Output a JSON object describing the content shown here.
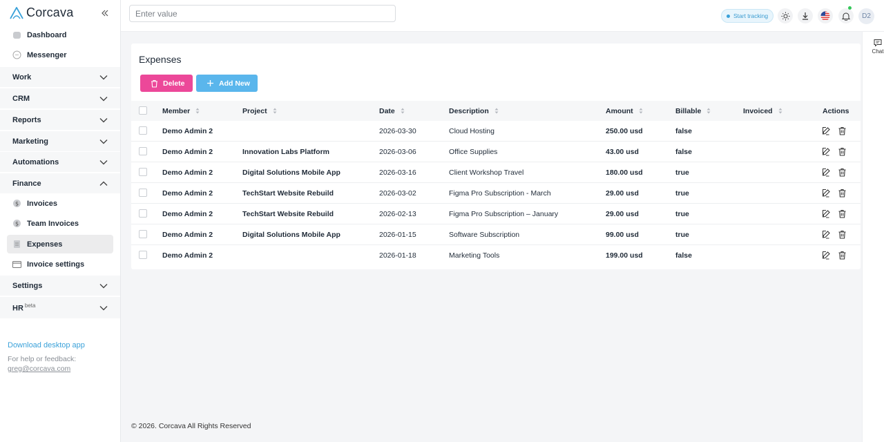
{
  "brand": {
    "name": "Corcava"
  },
  "sidebar": {
    "items": [
      {
        "label": "Dashboard",
        "icon": "home-icon"
      },
      {
        "label": "Messenger",
        "icon": "chat-bubble-icon"
      }
    ],
    "groups": [
      {
        "label": "Work",
        "expanded": false
      },
      {
        "label": "CRM",
        "expanded": false
      },
      {
        "label": "Reports",
        "expanded": false
      },
      {
        "label": "Marketing",
        "expanded": false
      },
      {
        "label": "Automations",
        "expanded": false
      },
      {
        "label": "Finance",
        "expanded": true
      }
    ],
    "finance_items": [
      {
        "label": "Invoices",
        "icon": "dollar-coin-icon"
      },
      {
        "label": "Team Invoices",
        "icon": "dollar-coin-icon"
      },
      {
        "label": "Expenses",
        "icon": "receipt-icon",
        "active": true
      },
      {
        "label": "Invoice settings",
        "icon": "card-icon"
      }
    ],
    "groups_after": [
      {
        "label": "Settings",
        "expanded": false
      },
      {
        "label": "HR",
        "badge": "beta",
        "expanded": false
      }
    ],
    "download_link": "Download desktop app",
    "help_text": "For help or feedback:",
    "help_email": "greg@corcava.com"
  },
  "topbar": {
    "search_placeholder": "Enter value",
    "track_label": "Start tracking",
    "avatar_initials": "D2",
    "accent": "#3aa1d9"
  },
  "chat": {
    "label": "Chat"
  },
  "expenses": {
    "title": "Expenses",
    "delete_label": "Delete",
    "add_label": "Add New",
    "columns": [
      "Member",
      "Project",
      "Date",
      "Description",
      "Amount",
      "Billable",
      "Invoiced",
      "Actions"
    ],
    "rows": [
      {
        "member": "Demo Admin 2",
        "project": "",
        "date": "2026-03-30",
        "description": "Cloud Hosting",
        "amount": "250.00 usd",
        "billable": "false",
        "invoiced": ""
      },
      {
        "member": "Demo Admin 2",
        "project": "Innovation Labs Platform",
        "date": "2026-03-06",
        "description": "Office Supplies",
        "amount": "43.00 usd",
        "billable": "false",
        "invoiced": ""
      },
      {
        "member": "Demo Admin 2",
        "project": "Digital Solutions Mobile App",
        "date": "2026-03-16",
        "description": "Client Workshop Travel",
        "amount": "180.00 usd",
        "billable": "true",
        "invoiced": ""
      },
      {
        "member": "Demo Admin 2",
        "project": "TechStart Website Rebuild",
        "date": "2026-03-02",
        "description": "Figma Pro Subscription - March",
        "amount": "29.00 usd",
        "billable": "true",
        "invoiced": ""
      },
      {
        "member": "Demo Admin 2",
        "project": "TechStart Website Rebuild",
        "date": "2026-02-13",
        "description": "Figma Pro Subscription – January",
        "amount": "29.00 usd",
        "billable": "true",
        "invoiced": ""
      },
      {
        "member": "Demo Admin 2",
        "project": "Digital Solutions Mobile App",
        "date": "2026-01-15",
        "description": "Software Subscription",
        "amount": "99.00 usd",
        "billable": "true",
        "invoiced": ""
      },
      {
        "member": "Demo Admin 2",
        "project": "",
        "date": "2026-01-18",
        "description": "Marketing Tools",
        "amount": "199.00 usd",
        "billable": "false",
        "invoiced": ""
      }
    ]
  },
  "footer": {
    "text": "© 2026. Corcava All Rights Reserved"
  },
  "colors": {
    "delete": "#ec4899",
    "add": "#5ab6ec",
    "link": "#3aa1d9"
  }
}
